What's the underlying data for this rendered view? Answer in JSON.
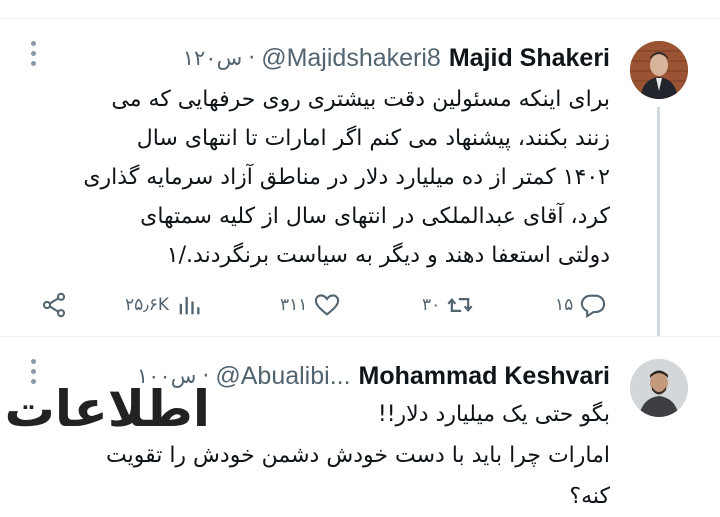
{
  "tweets": [
    {
      "name": "Majid Shakeri",
      "handle": "@Majidshakeri8",
      "time": "۱۲۰س",
      "body_lines": [
        "برای اینکه مسئولین دقت بیشتری روی حرفهایی که می",
        "زنند بکنند، پیشنهاد می کنم اگر امارات تا انتهای سال",
        "۱۴۰۲ کمتر از ده میلیارد دلار در مناطق آزاد سرمایه گذاری",
        "کرد، آقای عبدالملکی در انتهای سال از کلیه سمتهای",
        "دولتی استعفا دهند و دیگر به سیاست برنگردند./۱"
      ],
      "actions": {
        "replies": "۱۵",
        "retweets": "۳۰",
        "likes": "۳۱۱",
        "views": "۲۵٫۶K"
      }
    },
    {
      "name": "Mohammad Keshvari",
      "handle": "@Abualibi...",
      "time": "۱۰۰س",
      "body_lines": [
        "بگو حتی یک میلیارد دلار!!",
        "امارات چرا باید با دست خودش دشمن خودش را تقویت",
        "کنه؟"
      ]
    }
  ],
  "watermark": {
    "logo_text": "اطلاعات"
  },
  "icons": {
    "reply": "reply-icon",
    "retweet": "retweet-icon",
    "like": "heart-icon",
    "views": "views-icon",
    "share": "share-icon",
    "more": "more-icon"
  }
}
